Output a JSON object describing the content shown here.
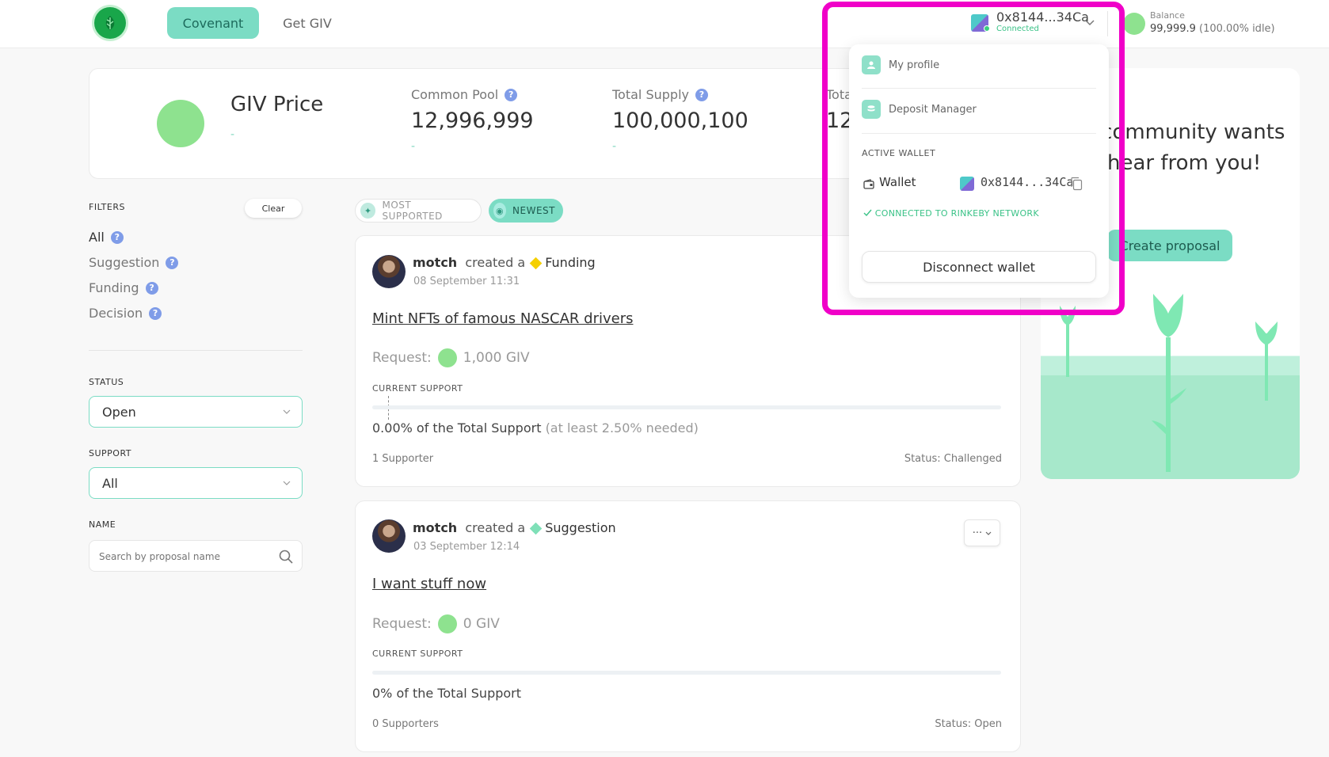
{
  "header": {
    "nav": {
      "covenant": "Covenant",
      "get_giv": "Get GIV"
    },
    "account": {
      "address": "0x8144...34Ca",
      "status": "Connected"
    },
    "balance": {
      "label": "Balance",
      "value": "99,999.9",
      "idle": "(100.00% idle)"
    }
  },
  "price_card": {
    "title": "GIV Price",
    "title_sub": "-",
    "stats": [
      {
        "label": "Common Pool",
        "value": "12,996,999",
        "sub": "-"
      },
      {
        "label": "Total Supply",
        "value": "100,000,100",
        "sub": "-"
      },
      {
        "label": "Tota",
        "value": "12,"
      }
    ]
  },
  "filters": {
    "title": "FILTERS",
    "clear": "Clear",
    "items": [
      "All",
      "Suggestion",
      "Funding",
      "Decision"
    ],
    "status_label": "STATUS",
    "status_value": "Open",
    "support_label": "SUPPORT",
    "support_value": "All",
    "name_label": "NAME",
    "name_placeholder": "Search by proposal name"
  },
  "sort": {
    "most_supported": "MOST SUPPORTED",
    "newest": "NEWEST"
  },
  "proposals": [
    {
      "author": "motch",
      "created_a": "created a",
      "type": "Funding",
      "type_color": "#f5d000",
      "date": "08 September 11:31",
      "title": "Mint NFTs of famous NASCAR drivers",
      "request_label": "Request:",
      "request_value": "1,000 GIV",
      "current_support": "CURRENT SUPPORT",
      "support_text": "0.00% of the Total Support",
      "support_needed": "(at least 2.50% needed)",
      "supporters": "1 Supporter",
      "status": "Status: Challenged"
    },
    {
      "author": "motch",
      "created_a": "created a",
      "type": "Suggestion",
      "type_color": "#7fe0b8",
      "date": "03 September 12:14",
      "title": "I want stuff now",
      "request_label": "Request:",
      "request_value": "0 GIV",
      "current_support": "CURRENT SUPPORT",
      "support_text": "0% of the Total Support",
      "supporters": "0 Supporters",
      "status": "Status: Open"
    }
  ],
  "community": {
    "text": "The community wants to hear from you!",
    "create": "Create proposal"
  },
  "dropdown": {
    "my_profile": "My profile",
    "deposit_manager": "Deposit Manager",
    "active_wallet": "ACTIVE WALLET",
    "wallet_label": "Wallet",
    "wallet_address": "0x8144...34Ca",
    "connected_network": "CONNECTED TO RINKEBY NETWORK",
    "disconnect": "Disconnect wallet"
  },
  "colors": {
    "accent": "#7bdcc4",
    "highlight": "#f000c8",
    "giv": "#8ee28f",
    "connected": "#3ac287"
  }
}
